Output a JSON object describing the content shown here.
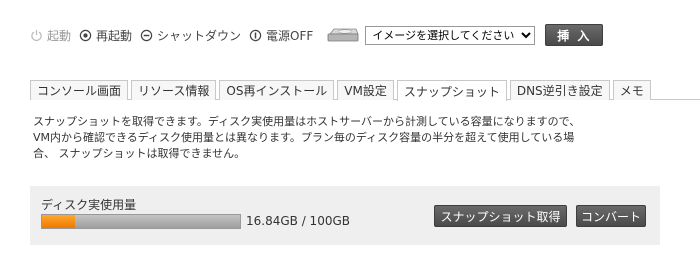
{
  "power": {
    "start_label": "起動",
    "restart_label": "再起動",
    "shutdown_label": "シャットダウン",
    "poweroff_label": "電源OFF"
  },
  "iso": {
    "selected": "イメージを選択してください",
    "insert_label": "挿 入"
  },
  "tabs": [
    {
      "label": "コンソール画面"
    },
    {
      "label": "リソース情報"
    },
    {
      "label": "OS再インストール"
    },
    {
      "label": "VM設定"
    },
    {
      "label": "スナップショット",
      "active": true
    },
    {
      "label": "DNS逆引き設定"
    },
    {
      "label": "メモ"
    }
  ],
  "description": {
    "line1": "スナップショットを取得できます。ディスク実使用量はホストサーバーから計測している容量になりますので、",
    "line2": "VM内から確認できるディスク使用量とは異なります。プラン毎のディスク容量の半分を超えて使用している場",
    "line3": "合、 スナップショットは取得できません。"
  },
  "disk": {
    "label": "ディスク実使用量",
    "usage_text": "16.84GB / 100GB",
    "used_fraction": 0.1684
  },
  "buttons": {
    "snapshot_label": "スナップショット取得",
    "convert_label": "コンバート"
  },
  "colors": {
    "accent": "#f07800",
    "button_dark": "#555555"
  }
}
